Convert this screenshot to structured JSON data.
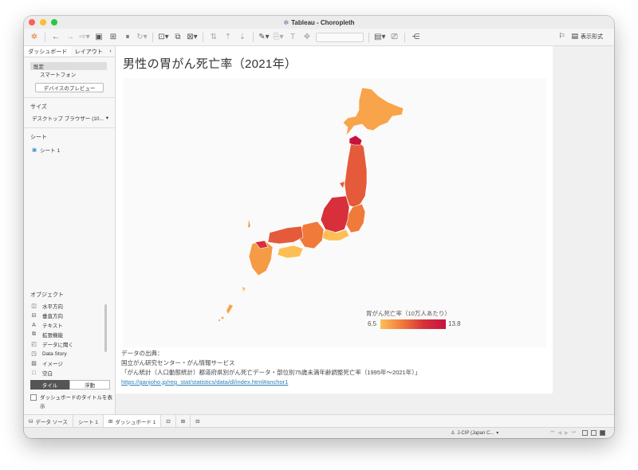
{
  "window": {
    "title": "Tableau - Choropleth"
  },
  "toolbar": {
    "show_me_label": "表示形式"
  },
  "sidebar": {
    "tabs": [
      "ダッシュボード",
      "レイアウト"
    ],
    "collapse_glyph": "‹",
    "device": {
      "default": "既定",
      "phone": "スマートフォン"
    },
    "preview_button": "デバイスのプレビュー",
    "size_heading": "サイズ",
    "size_value": "デスクトップ ブラウザー (10...",
    "sheets_heading": "シート",
    "sheets": [
      "シート 1"
    ],
    "objects_heading": "オブジェクト",
    "objects": [
      {
        "label": "水平方向",
        "icon": "horizontal-container-icon"
      },
      {
        "label": "垂直方向",
        "icon": "vertical-container-icon"
      },
      {
        "label": "テキスト",
        "icon": "text-icon"
      },
      {
        "label": "拡張機能",
        "icon": "extension-icon"
      },
      {
        "label": "データに聞く",
        "icon": "ask-data-icon"
      },
      {
        "label": "Data Story",
        "icon": "data-story-icon"
      },
      {
        "label": "イメージ",
        "icon": "image-icon"
      },
      {
        "label": "空白",
        "icon": "blank-icon"
      }
    ],
    "tile_label": "タイル",
    "float_label": "浮動",
    "show_title_label": "ダッシュボードのタイトルを表示"
  },
  "dashboard": {
    "title": "男性の胃がん死亡率（2021年）",
    "legend": {
      "title": "胃がん死亡率（10万人あたり）",
      "min": "6.5",
      "max": "13.8"
    },
    "source": {
      "line1": "データの出典：",
      "line2": "国立がん研究センター・がん情報サービス",
      "line3": "「がん統計（人口動態統計）都道府県別がん死亡データ・部位別75歳未満年齢調整死亡率（1995年～2021年）」",
      "link": "https://ganjoho.jp/reg_stat/statistics/data/dl/index.html#anchor1"
    }
  },
  "colors": {
    "low": "#fdbf55",
    "mid": "#f07a3a",
    "high": "#c8123e"
  },
  "statusbar": {
    "data_source": "データ ソース",
    "sheet_tab": "シート 1",
    "dashboard_tab": "ダッシュボード 1",
    "language": "J-CIP (Japan C..."
  }
}
